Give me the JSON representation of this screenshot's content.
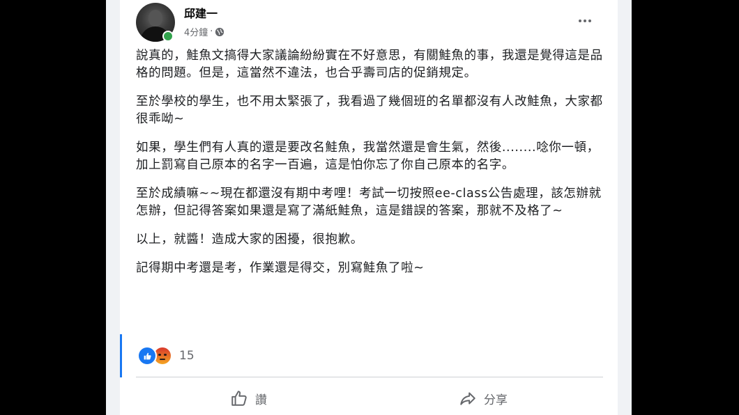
{
  "post": {
    "author": "邱建一",
    "time": "4分鐘",
    "separator": "·",
    "privacy_icon": "globe-icon",
    "paragraphs": [
      "說真的，鮭魚文搞得大家議論紛紛實在不好意思，有關鮭魚的事，我還是覺得這是品格的問題。但是，這當然不違法，也合乎壽司店的促銷規定。",
      "至於學校的學生，也不用太緊張了，我看過了幾個班的名單都沒有人改鮭魚，大家都很乖呦~",
      "如果，學生們有人真的還是要改名鮭魚，我當然還是會生氣，然後........唸你一頓，加上罰寫自己原本的名字一百遍，這是怕你忘了你自己原本的名字。",
      "至於成績嘛~~現在都還沒有期中考哩！考試一切按照ee-class公告處理，該怎辦就怎辦，但記得答案如果還是寫了滿紙鮭魚，這是錯誤的答案，那就不及格了~",
      "以上，就醬！造成大家的困擾，很抱歉。",
      "記得期中考還是考，作業還是得交，別寫鮭魚了啦~"
    ]
  },
  "reactions": {
    "count": "15",
    "types": [
      "like-icon",
      "angry-icon"
    ]
  },
  "actions": {
    "like_label": "讚",
    "share_label": "分享"
  },
  "colors": {
    "accent": "#1877f2",
    "online": "#31a24c",
    "secondary_text": "#65676b"
  }
}
